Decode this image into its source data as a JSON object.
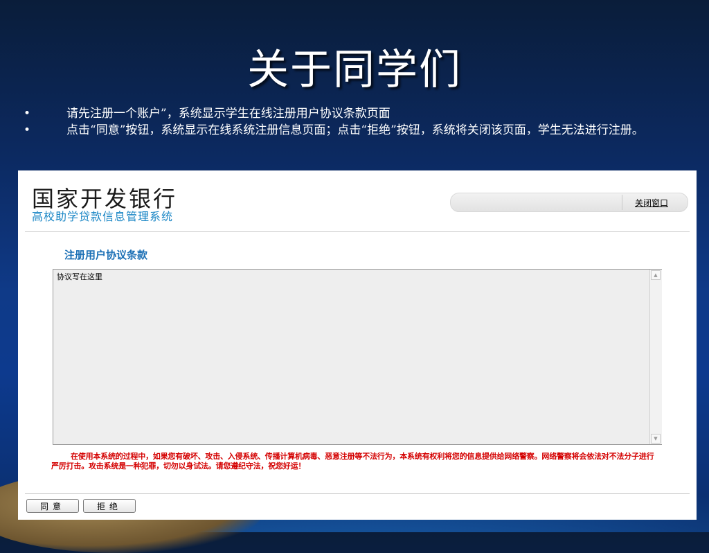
{
  "slide": {
    "title": "关于同学们",
    "bullets": [
      {
        "marker": "•",
        "text": "请先注册一个账户”，系统显示学生在线注册用户协议条款页面"
      },
      {
        "marker": "•",
        "text": "点击“同意”按钮，系统显示在线系统注册信息页面；点击“拒绝”按钮，系统将关闭该页面，学生无法进行注册。"
      }
    ]
  },
  "screenshot": {
    "brand": {
      "name": "国家开发银行",
      "subtitle": "高校助学贷款信息管理系统"
    },
    "header": {
      "close_label": "关闭窗口"
    },
    "agreement": {
      "title": "注册用户协议条款",
      "text": "协议写在这里"
    },
    "warning": "在使用本系统的过程中，如果您有破坏、攻击、入侵系统、传播计算机病毒、恶意注册等不法行为，本系统有权利将您的信息提供给网络警察。网络警察将会依法对不法分子进行严厉打击。攻击系统是一种犯罪，切勿以身试法。请您遵纪守法，祝您好运！",
    "buttons": {
      "agree": "同意",
      "reject": "拒绝"
    }
  },
  "colors": {
    "accent_blue": "#1a6fb5",
    "warning_red": "#d40000",
    "subtitle_blue": "#1a86c5"
  }
}
